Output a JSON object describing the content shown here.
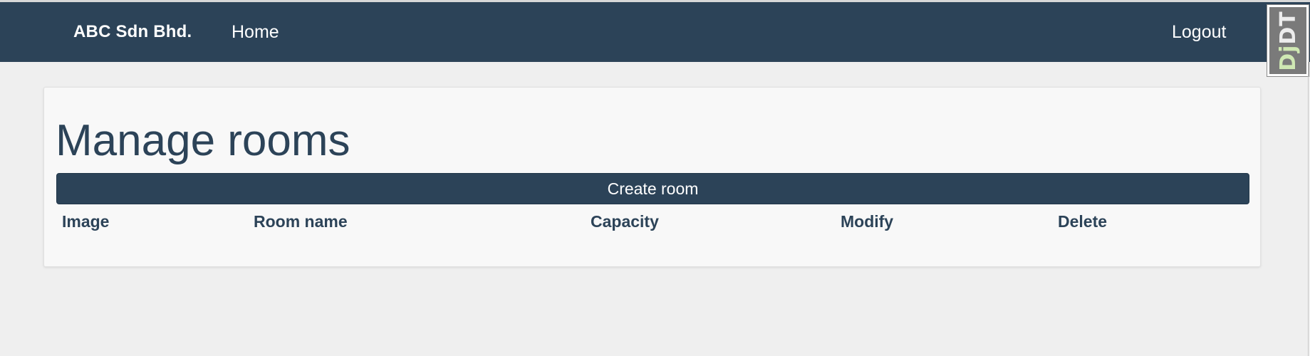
{
  "navbar": {
    "brand": "ABC Sdn Bhd.",
    "home_label": "Home",
    "logout_label": "Logout"
  },
  "debug_toolbar": {
    "label_prefix": "Dj",
    "label_suffix": "DT"
  },
  "main": {
    "title": "Manage rooms",
    "create_button_label": "Create room",
    "table": {
      "columns": [
        "Image",
        "Room name",
        "Capacity",
        "Modify",
        "Delete"
      ],
      "rows": []
    }
  },
  "colors": {
    "primary": "#2c4358",
    "page_background": "#efefef",
    "card_background": "#f8f8f8"
  }
}
